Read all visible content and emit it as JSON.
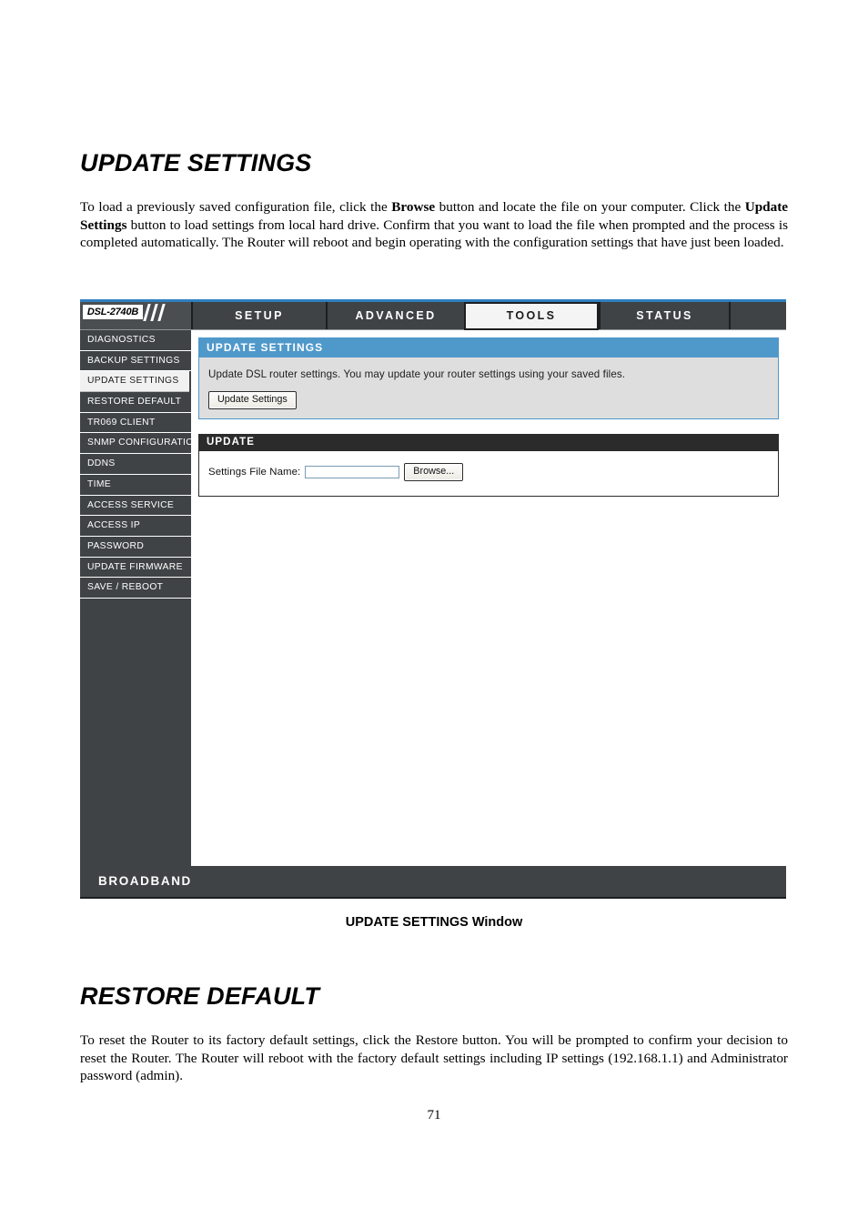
{
  "document": {
    "heading_1": "UPDATE SETTINGS",
    "paragraph_1_html": "To load a previously saved configuration file, click the <b>Browse</b> button and locate the file on your computer. Click the <b>Update Settings</b> button to load settings from local hard drive. Confirm that you want to load the file when prompted and the process is completed automatically. The Router will reboot and begin operating with the configuration settings that have just been loaded.",
    "figure_caption": "UPDATE SETTINGS Window",
    "heading_2": "RESTORE DEFAULT",
    "paragraph_2_html": "To reset the Router to its factory default settings, click the Restore button. You will be prompted to confirm your decision to reset the Router. The Router will reboot with the factory default settings including IP settings (192.168.1.1) and Administrator password (admin).",
    "page_number": "71"
  },
  "router_ui": {
    "logo": {
      "model": "DSL-2740B",
      "slashes_icon": "slashes-icon"
    },
    "nav_tabs": [
      {
        "label": "SETUP",
        "active": false
      },
      {
        "label": "ADVANCED",
        "active": false
      },
      {
        "label": "TOOLS",
        "active": true
      },
      {
        "label": "STATUS",
        "active": false
      }
    ],
    "sidebar": {
      "items": [
        {
          "label": "DIAGNOSTICS",
          "selected": false
        },
        {
          "label": "BACKUP SETTINGS",
          "selected": false
        },
        {
          "label": "UPDATE SETTINGS",
          "selected": true
        },
        {
          "label": "RESTORE DEFAULT",
          "selected": false
        },
        {
          "label": "TR069 CLIENT",
          "selected": false
        },
        {
          "label": "SNMP CONFIGURATION",
          "selected": false
        },
        {
          "label": "DDNS",
          "selected": false
        },
        {
          "label": "TIME",
          "selected": false
        },
        {
          "label": "ACCESS SERVICE",
          "selected": false
        },
        {
          "label": "ACCESS IP",
          "selected": false
        },
        {
          "label": "PASSWORD",
          "selected": false
        },
        {
          "label": "UPDATE FIRMWARE",
          "selected": false
        },
        {
          "label": "SAVE / REBOOT",
          "selected": false
        }
      ]
    },
    "update_settings_panel": {
      "title": "UPDATE SETTINGS",
      "description": "Update DSL router settings. You may update your router settings using your saved files.",
      "button_label": "Update Settings"
    },
    "update_panel": {
      "title": "UPDATE",
      "field_label": "Settings File Name:",
      "field_value": "",
      "field_placeholder": "",
      "browse_button_label": "Browse..."
    },
    "footer": {
      "brand": "BROADBAND"
    },
    "colors": {
      "accent_blue": "#4f98ca",
      "top_strip_blue": "#2f7fbf",
      "dark_chrome": "#3f4345",
      "panel_dark": "#2b2b2b",
      "panel_grey": "#dedede",
      "selected_item": "#f1f1f1"
    }
  }
}
